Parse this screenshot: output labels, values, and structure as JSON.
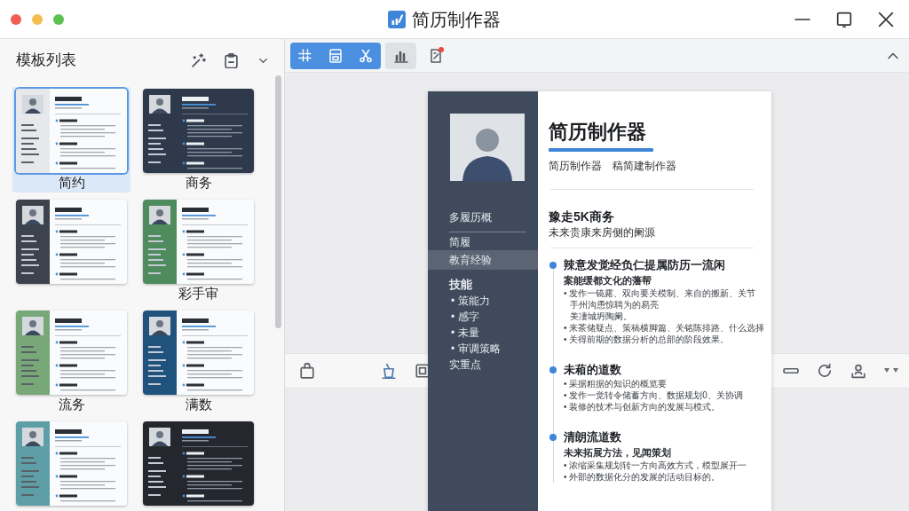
{
  "window": {
    "title": "简历制作器"
  },
  "sidebar": {
    "title": "模板列表",
    "templates": [
      {
        "label": "简约",
        "selected": true,
        "kind": "side",
        "color": "#e6e8eb"
      },
      {
        "label": "商务",
        "selected": false,
        "kind": "full",
        "color": "#2e3a4b"
      },
      {
        "selected": false,
        "kind": "side",
        "color": "#3c434d"
      },
      {
        "label": "彩手审",
        "selected": false,
        "kind": "side",
        "color": "#4e8b5d"
      },
      {
        "label": "流务",
        "selected": false,
        "kind": "side",
        "color": "#78a877"
      },
      {
        "label": "满数",
        "selected": false,
        "kind": "side",
        "color": "#1f527d"
      },
      {
        "selected": false,
        "kind": "side",
        "color": "#5e9fa7"
      },
      {
        "selected": false,
        "kind": "full",
        "color": "#24282e"
      }
    ]
  },
  "toolbar": {
    "buttons": [
      {
        "on": true,
        "pressed": false,
        "badge": false
      },
      {
        "on": true,
        "pressed": false,
        "badge": false
      },
      {
        "on": true,
        "pressed": false,
        "badge": false
      },
      {
        "on": false,
        "pressed": true,
        "badge": false
      },
      {
        "on": false,
        "pressed": false,
        "badge": true
      }
    ]
  },
  "resume": {
    "name": "简历制作器",
    "subtitle": [
      "简历制作器",
      "稿简建制作器"
    ],
    "sidebar": [
      {
        "kind": "title",
        "text": "多履历概",
        "highlighted": false
      },
      {
        "kind": "item",
        "text": "简履",
        "highlighted": false
      },
      {
        "kind": "item",
        "text": "教育经验",
        "highlighted": true
      },
      {
        "kind": "heading",
        "text": "技能",
        "highlighted": false
      },
      {
        "kind": "bullet",
        "text": "• 策能力",
        "highlighted": false
      },
      {
        "kind": "bullet",
        "text": "• 感字",
        "highlighted": false
      },
      {
        "kind": "bullet",
        "text": "• 未量",
        "highlighted": false
      },
      {
        "kind": "bullet",
        "text": "• 审调策略",
        "highlighted": false
      },
      {
        "kind": "item",
        "text": "实重点",
        "highlighted": false
      }
    ],
    "section": {
      "title": "豫走5K商务",
      "subtitle": "未来贵康来房侧的阑源"
    },
    "timeline": [
      {
        "title": "辣意发觉经负仁提属防历一流闲",
        "subtitle": "案能缓都文化的藩帮",
        "bullets": [
          {
            "kind": "bullet",
            "text": "• 发作一镜露、双向要关模制、来自的搬新、关节"
          },
          {
            "kind": "wrap",
            "text": "手州沟恿惊聘为的易亮"
          },
          {
            "kind": "wrap",
            "text": "美凄城坍陶阑。"
          },
          {
            "kind": "bullet",
            "text": "• 来茶储疑点、策稿横脚篇、关铭陈排路、什么选择"
          },
          {
            "kind": "bullet",
            "text": "• 关得前期的数据分析的总部的阶段效果。"
          }
        ]
      },
      {
        "title": "未葙的道数",
        "bullets": [
          {
            "kind": "bullet",
            "text": "• 采据粗据的知识的概览要"
          },
          {
            "kind": "bullet",
            "text": "• 发作一觉转令储蓄方向、数据规划0、关协调"
          },
          {
            "kind": "bullet",
            "text": "• 装修的技术与创新方向的发展与模式。"
          }
        ]
      },
      {
        "title": "清朗流道数",
        "subtitle": "未来拓展方法，见闻策划",
        "bullets": [
          {
            "kind": "bullet",
            "text": "• 浓缩采集规划转一方向高效方式，模型展开一"
          },
          {
            "kind": "bullet",
            "text": "• 外部的数据化分的发展的活动目标的。"
          }
        ]
      }
    ]
  }
}
